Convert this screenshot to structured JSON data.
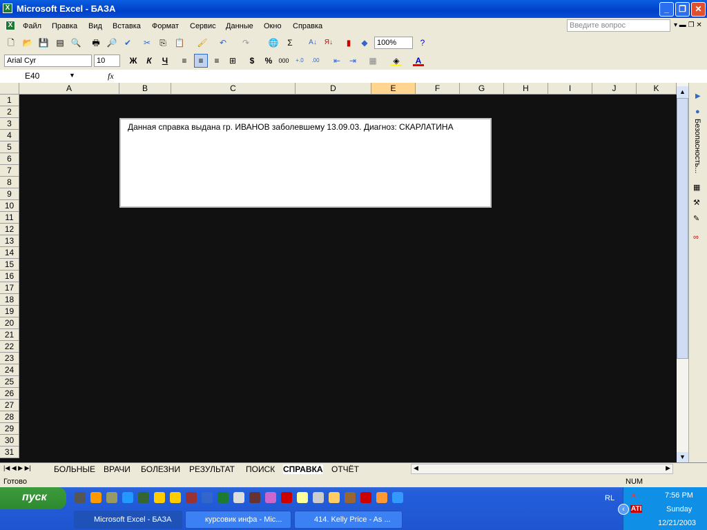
{
  "window": {
    "title": "Microsoft Excel - БАЗА"
  },
  "menu": [
    "Файл",
    "Правка",
    "Вид",
    "Вставка",
    "Формат",
    "Сервис",
    "Данные",
    "Окно",
    "Справка"
  ],
  "help_placeholder": "Введите вопрос",
  "toolbar": {
    "zoom": "100%",
    "font": "Arial Cyr",
    "size": "10",
    "bold": "Ж",
    "italic": "К",
    "underline": "Ч",
    "currency": "$",
    "percent": "%",
    "thousands": "000"
  },
  "formula": {
    "name_box": "E40",
    "fx": "fx",
    "value": ""
  },
  "columns": [
    "A",
    "B",
    "C",
    "D",
    "E",
    "F",
    "G",
    "H",
    "I",
    "J",
    "K"
  ],
  "rows": [
    "1",
    "2",
    "3",
    "4",
    "5",
    "6",
    "7",
    "8",
    "9",
    "10",
    "11",
    "12",
    "13",
    "14",
    "15",
    "16",
    "17",
    "18",
    "19",
    "20",
    "21",
    "22",
    "23",
    "24",
    "25",
    "26",
    "27",
    "28",
    "29",
    "30",
    "31"
  ],
  "textbox": "Данная справка выдана гр. ИВАНОВ заболевшему 13.09.03. Диагноз: СКАРЛАТИНА",
  "taskpane": {
    "label": "Безопасность..."
  },
  "sheets": [
    "БОЛЬНЫЕ",
    "ВРАЧИ",
    "БОЛЕЗНИ",
    "РЕЗУЛЬТАТ",
    "ПОИСК",
    "СПРАВКА",
    "ОТЧЁТ"
  ],
  "active_sheet": "СПРАВКА",
  "status": {
    "left": "Готово",
    "num": "NUM"
  },
  "taskbar": {
    "start": "пуск",
    "lang": "RL",
    "buttons": [
      "Microsoft Excel - БАЗА",
      "курсовик инфа - Mic...",
      "414. Kelly Price - As ..."
    ],
    "time": "7:56 PM",
    "day": "Sunday",
    "date": "12/21/2003"
  }
}
